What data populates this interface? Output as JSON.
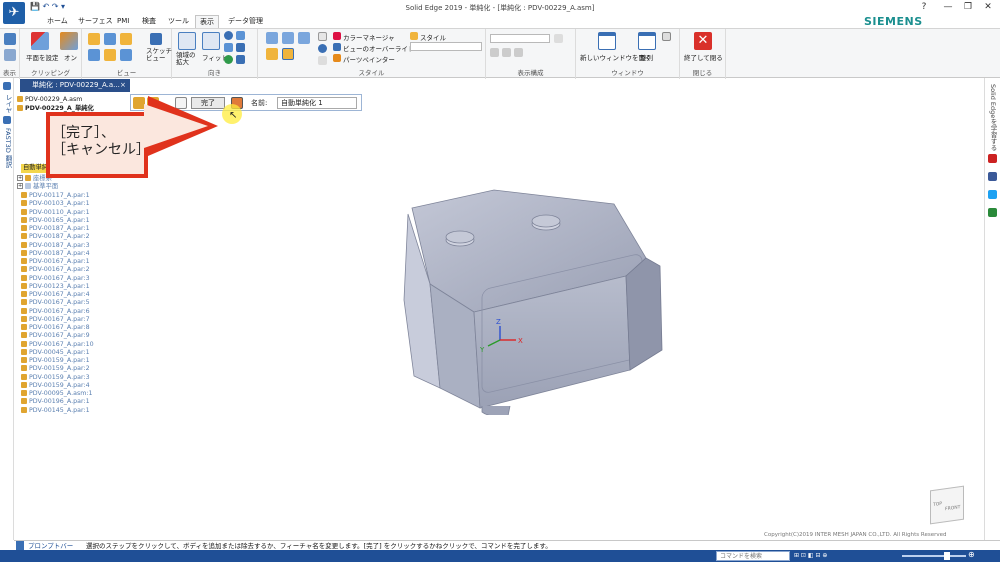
{
  "window": {
    "title": "Solid Edge 2019 - 単純化 - [単純化 : PDV-00229_A.asm]",
    "brand": "SIEMENS",
    "controls": [
      "?",
      "—",
      "❐",
      "✕"
    ]
  },
  "tabs": [
    "ホーム",
    "サーフェス",
    "PMI",
    "検査",
    "ツール",
    "表示",
    "データ管理"
  ],
  "active_tab": "表示",
  "ribbon": {
    "groups": [
      {
        "label": "表示",
        "buttons": []
      },
      {
        "label": "クリッピング",
        "buttons": [
          "平面を設定",
          "オン"
        ]
      },
      {
        "label": "ビュー",
        "buttons": [
          "スケッチビュー"
        ]
      },
      {
        "label": "向き",
        "buttons": [
          "領域の拡大",
          "フィット"
        ]
      },
      {
        "label": "スタイル",
        "buttons": [
          "カラーマネージャ",
          "ビューのオーバーライド",
          "パーツペインター",
          "スタイル"
        ]
      },
      {
        "label": "表示構成",
        "buttons": []
      },
      {
        "label": "ウィンドウ",
        "buttons": [
          "新しいウィンドウを開く",
          "整列"
        ]
      },
      {
        "label": "閉じる",
        "buttons": [
          "終了して閉る"
        ]
      }
    ]
  },
  "document_tab": {
    "label": "単純化 : PDV-00229_A.a...",
    "close": "×"
  },
  "command_bar": {
    "finish_label": "完了",
    "name_label": "名前:",
    "name_value": "自動単純化 1"
  },
  "left_rail": [
    "レイヤ",
    "FAST3D 翻訳"
  ],
  "right_rail": [
    "Solid Edgeを学習する"
  ],
  "callout": {
    "line1": "［完了］、",
    "line2": "［キャンセル］"
  },
  "tree": {
    "top_items": [
      "PDV-00229_A.asm",
      "PDV-00229_A_単純化"
    ],
    "feature_label": "自動単純化 1",
    "group_items": [
      "座標系",
      "基準平面"
    ],
    "parts": [
      "PDV-00117_A.par:1",
      "PDV-00103_A.par:1",
      "PDV-00110_A.par:1",
      "PDV-00165_A.par:1",
      "PDV-00187_A.par:1",
      "PDV-00187_A.par:2",
      "PDV-00187_A.par:3",
      "PDV-00187_A.par:4",
      "PDV-00167_A.par:1",
      "PDV-00167_A.par:2",
      "PDV-00167_A.par:3",
      "PDV-00123_A.par:1",
      "PDV-00167_A.par:4",
      "PDV-00167_A.par:5",
      "PDV-00167_A.par:6",
      "PDV-00167_A.par:7",
      "PDV-00167_A.par:8",
      "PDV-00167_A.par:9",
      "PDV-00167_A.par:10",
      "PDV-00045_A.par:1",
      "PDV-00159_A.par:1",
      "PDV-00159_A.par:2",
      "PDV-00159_A.par:3",
      "PDV-00159_A.par:4",
      "PDV-00095_A.asm:1",
      "PDV-00196_A.par:1",
      "PDV-00145_A.par:1"
    ]
  },
  "viewport": {
    "triad": {
      "x": "X",
      "y": "Y",
      "z": "Z"
    },
    "view_cube": [
      "TOP",
      "FRONT"
    ]
  },
  "prompt_bar": {
    "label": "プロンプトバー",
    "message": "選択のステップをクリックして、ボディを追加または除去するか、フィーチャ名を変更します。[完了] をクリックするかねクリックで、コマンドを完了します。"
  },
  "copyright": "Copyright(C)2019 INTER MESH JAPAN CO.,LTD. All Rights Reserved",
  "status": {
    "search_placeholder": "コマンドを検索"
  },
  "colors": {
    "accent": "#1f4f96",
    "callout": "#e0321c",
    "model": "#aeb3c3"
  }
}
